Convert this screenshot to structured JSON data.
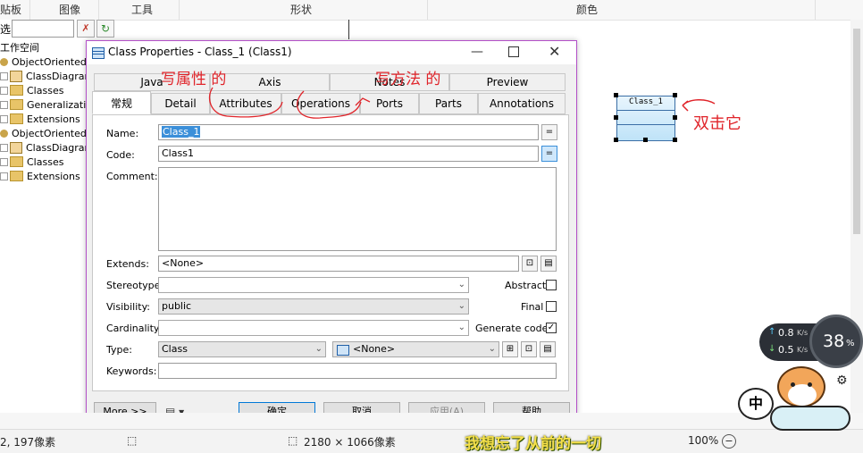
{
  "ribbon": {
    "items": [
      "贴板",
      "图像",
      "工具",
      "形状",
      "颜色"
    ]
  },
  "tree": {
    "filter_prefix": "选",
    "workspace_label": "工作空间",
    "rows": [
      {
        "label": "ObjectOrientedMo",
        "kind": "model"
      },
      {
        "label": "ClassDiagram_",
        "kind": "diagram"
      },
      {
        "label": "Classes",
        "kind": "folder"
      },
      {
        "label": "Generalization",
        "kind": "folder"
      },
      {
        "label": "Extensions",
        "kind": "folder"
      },
      {
        "label": "ObjectOrientedMo",
        "kind": "model"
      },
      {
        "label": "ClassDiagram_",
        "kind": "diagram"
      },
      {
        "label": "Classes",
        "kind": "folder"
      },
      {
        "label": "Extensions",
        "kind": "folder"
      }
    ]
  },
  "dialog": {
    "title": "Class Properties - Class_1 (Class1)",
    "tabs_row1": [
      "Java",
      "Axis",
      "Notes",
      "Preview"
    ],
    "tabs_row2": [
      "常规",
      "Detail",
      "Attributes",
      "Operations",
      "Ports",
      "Parts",
      "Annotations"
    ],
    "fields": {
      "name_label": "Name:",
      "name_value": "Class_1",
      "code_label": "Code:",
      "code_value": "Class1",
      "comment_label": "Comment:",
      "extends_label": "Extends:",
      "extends_value": "<None>",
      "stereotype_label": "Stereotype:",
      "stereotype_value": "",
      "visibility_label": "Visibility:",
      "visibility_value": "public",
      "cardinality_label": "Cardinality:",
      "cardinality_value": "",
      "type_label": "Type:",
      "type_value": "Class",
      "type_second_value": "<None>",
      "keywords_label": "Keywords:",
      "keywords_value": ""
    },
    "checks": {
      "abstract_label": "Abstract",
      "abstract_checked": false,
      "final_label": "Final",
      "final_checked": false,
      "generate_label": "Generate code",
      "generate_checked": true
    },
    "buttons": {
      "more": "More >>",
      "ok": "确定",
      "cancel": "取消",
      "apply": "应用(A)",
      "help": "帮助"
    },
    "equals_symbol": "="
  },
  "canvas": {
    "class_box_label": "Class_1"
  },
  "annotations": {
    "write_attr": "写属性 的",
    "write_method": "写方法 的",
    "double_click": "双击它"
  },
  "status": {
    "left": "2, 197像素",
    "dimensions": "2180 × 1066像素",
    "zoom": "100%",
    "subtitle": "我想忘了从前的一切"
  },
  "widget": {
    "upload": "0.8",
    "download": "0.5",
    "unit": "K/s",
    "percent": "38",
    "percent_sign": "%",
    "mascot_char": "中"
  },
  "colors": {
    "dialog_border": "#b350c8",
    "annotation_red": "#e0242a",
    "name_highlight": "#3b8fd9",
    "class_fill": "#cde9fb"
  }
}
